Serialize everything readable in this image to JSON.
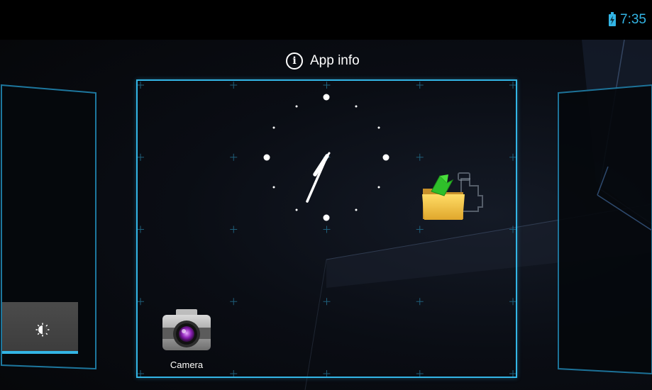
{
  "status_bar": {
    "time": "7:35",
    "battery_icon": "battery-charging-icon",
    "accent_color": "#33b5e5"
  },
  "drop_target": {
    "label": "App info",
    "icon": "info-icon"
  },
  "workspace": {
    "selected_page_border_color": "#33b5e5",
    "widgets": [
      {
        "type": "analog-clock",
        "hour_hand": "7",
        "minute_hand": "35"
      },
      {
        "type": "folder-shortcut",
        "icon": "folder-arrow-icon"
      },
      {
        "type": "power-control-brightness",
        "icon": "brightness-icon"
      }
    ],
    "apps": [
      {
        "label": "Camera",
        "icon": "camera-icon"
      }
    ]
  }
}
